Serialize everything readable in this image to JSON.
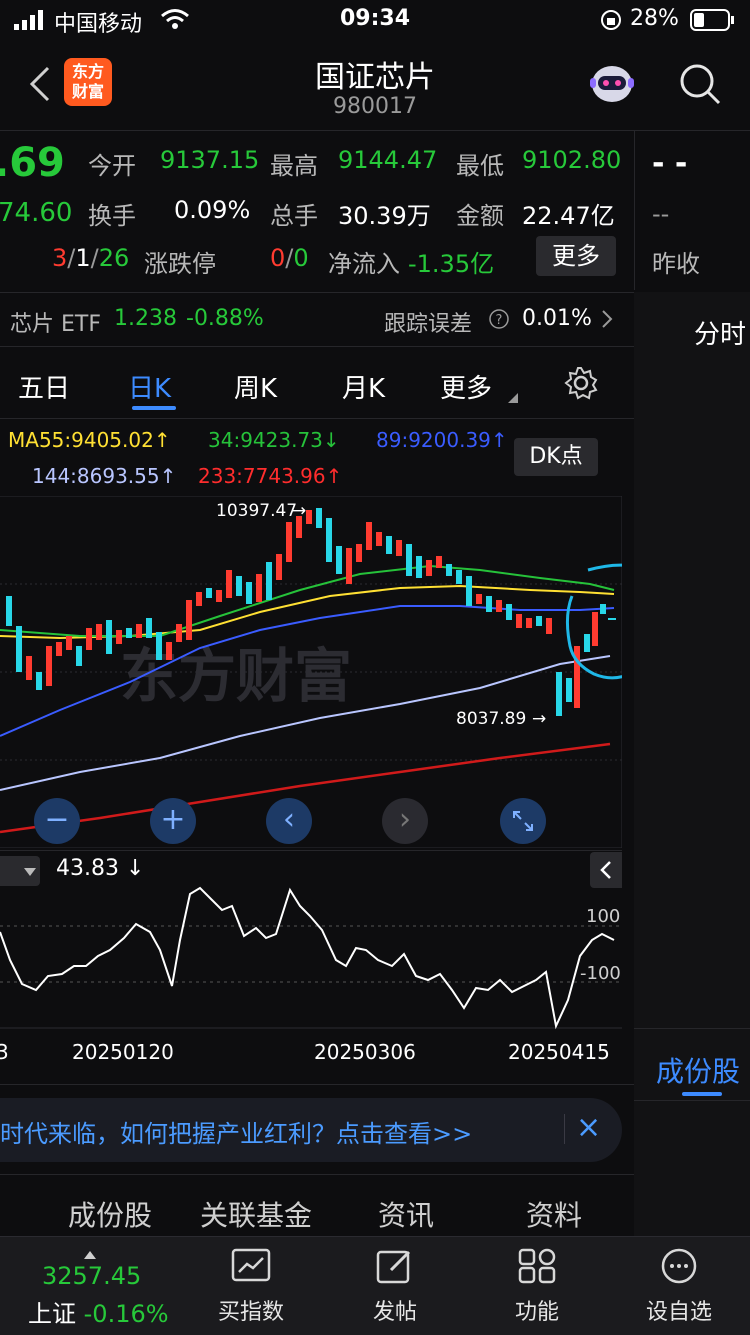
{
  "status_bar": {
    "carrier": "中国移动",
    "time": "09:34",
    "battery": "28%"
  },
  "header": {
    "title": "国证芯片",
    "code": "980017",
    "logo_line1": "东方",
    "logo_line2": "财富"
  },
  "quote": {
    "price": ".69",
    "change": "74.60",
    "open_label": "今开",
    "open": "9137.15",
    "high_label": "最高",
    "high": "9144.47",
    "low_label": "最低",
    "low": "9102.80",
    "turnover_label": "换手",
    "turnover": "0.09%",
    "volume_label": "总手",
    "volume": "30.39万",
    "amount_label": "金额",
    "amount": "22.47亿",
    "updown_up": "3",
    "updown_flat": "1",
    "updown_down": "26",
    "updown_label": "涨跌停",
    "limit_up": "0",
    "limit_down": "0",
    "netflow_label": "净流入",
    "netflow": "-1.35亿",
    "more_button": "更多",
    "right_dash1": "-  -",
    "right_dash2": "--",
    "prev_close_label": "昨收"
  },
  "etf": {
    "name": "芯片 ETF",
    "price": "1.238",
    "change": "-0.88%",
    "tracking_label": "跟踪误差",
    "tracking_value": "0.01%"
  },
  "side_tabs": {
    "intraday": "分时",
    "components": "成份股"
  },
  "kline_tabs": [
    "五日",
    "日K",
    "周K",
    "月K",
    "更多"
  ],
  "ma": {
    "ma55": "MA55:9405.02",
    "ma34": "34:9423.73",
    "ma89": "89:9200.39",
    "ma144": "144:8693.55",
    "ma233": "233:7743.96",
    "ma55_arrow": "↑",
    "ma34_arrow": "↓",
    "ma89_arrow": "↑",
    "ma144_arrow": "↑",
    "ma233_arrow": "↑"
  },
  "dk_button": "DK点",
  "chart": {
    "high_label": "10397.47",
    "low_label": "8037.89",
    "watermark": "东方财富"
  },
  "indicator": {
    "value": "43.83",
    "arrow": "↓",
    "level_top": "100",
    "level_bottom": "-100"
  },
  "dates": [
    "3",
    "20250120",
    "20250306",
    "20250415"
  ],
  "banner": {
    "text": "时代来临，如何把握产业红利？点击查看>>",
    "close": "×"
  },
  "section_tabs": [
    "成份股",
    "关联基金",
    "资讯",
    "资料"
  ],
  "bottom_nav": {
    "index_value": "3257.45",
    "index_name": "上证",
    "index_change": "-0.16%",
    "items": [
      "买指数",
      "发帖",
      "功能",
      "设自选"
    ]
  },
  "colors": {
    "up": "#ff3b30",
    "down": "#27c93a",
    "accent": "#3d8bff",
    "ma55": "#ffe033",
    "ma34": "#26c23a",
    "ma89": "#3a5cff",
    "ma144": "#b9c6ff",
    "ma233": "#d01a1a"
  }
}
